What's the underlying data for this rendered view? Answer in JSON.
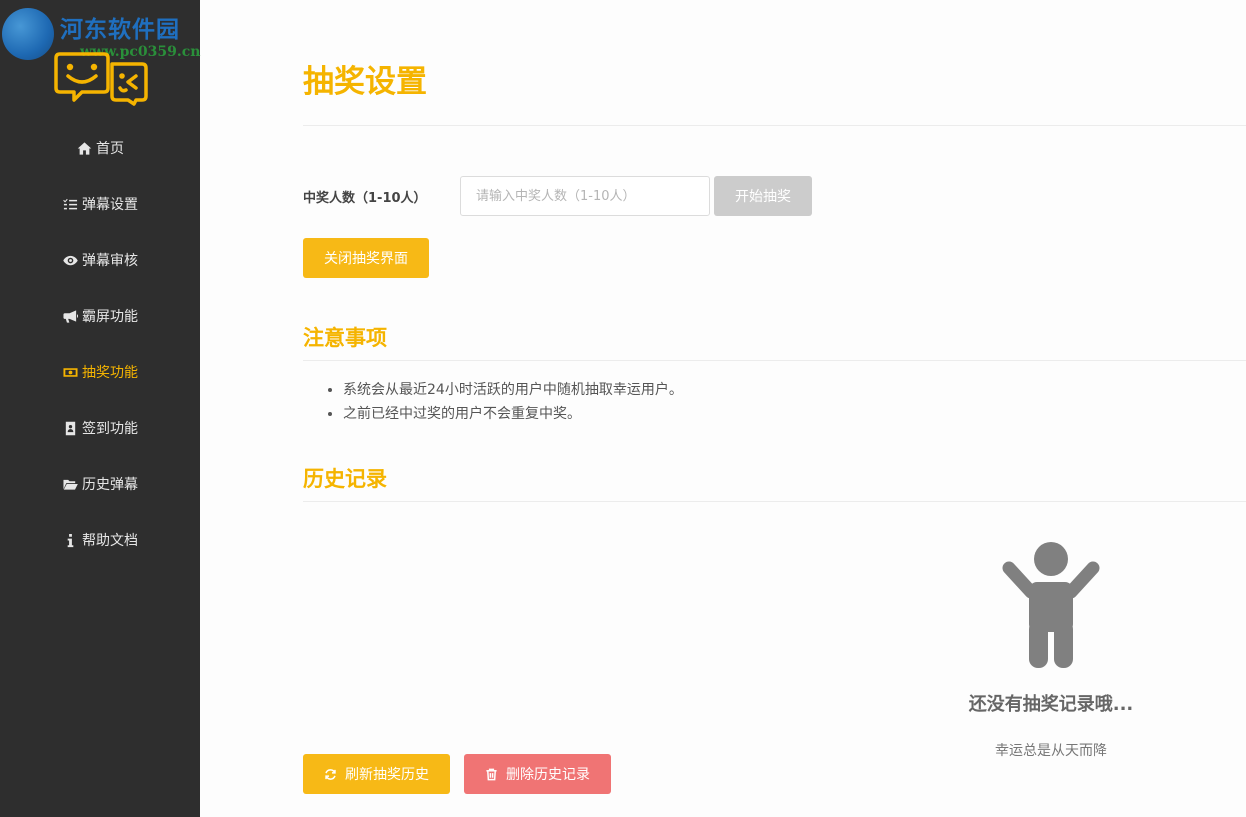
{
  "watermark": {
    "title": "河东软件园",
    "url": "www.pc0359.cn"
  },
  "logo": {
    "icon": "smile-chat-bubbles-icon",
    "color": "#f5b400"
  },
  "sidebar": {
    "items": [
      {
        "label": "首页",
        "icon": "home-icon"
      },
      {
        "label": "弹幕设置",
        "icon": "list-check-icon"
      },
      {
        "label": "弹幕审核",
        "icon": "eye-icon"
      },
      {
        "label": "霸屏功能",
        "icon": "bullhorn-icon"
      },
      {
        "label": "抽奖功能",
        "icon": "money-bill-icon",
        "active": true
      },
      {
        "label": "签到功能",
        "icon": "id-badge-icon"
      },
      {
        "label": "历史弹幕",
        "icon": "folder-open-icon"
      },
      {
        "label": "帮助文档",
        "icon": "info-icon"
      }
    ]
  },
  "page": {
    "title": "抽奖设置"
  },
  "form": {
    "label": "中奖人数（1-10人）",
    "input_value": "",
    "input_placeholder": "请输入中奖人数（1-10人）",
    "start_label": "开始抽奖",
    "close_label": "关闭抽奖界面"
  },
  "notes": {
    "title": "注意事项",
    "items": [
      "系统会从最近24小时活跃的用户中随机抽取幸运用户。",
      "之前已经中过奖的用户不会重复中奖。"
    ]
  },
  "history": {
    "title": "历史记录",
    "empty_icon": "person-arms-up-icon",
    "empty_title": "还没有抽奖记录哦...",
    "empty_subtitle": "幸运总是从天而降",
    "refresh_label": "刷新抽奖历史",
    "delete_label": "删除历史记录"
  },
  "colors": {
    "accent": "#f5b400",
    "sidebar_bg": "#2e2e2e",
    "danger": "#f07474",
    "disabled": "#cccccc"
  }
}
